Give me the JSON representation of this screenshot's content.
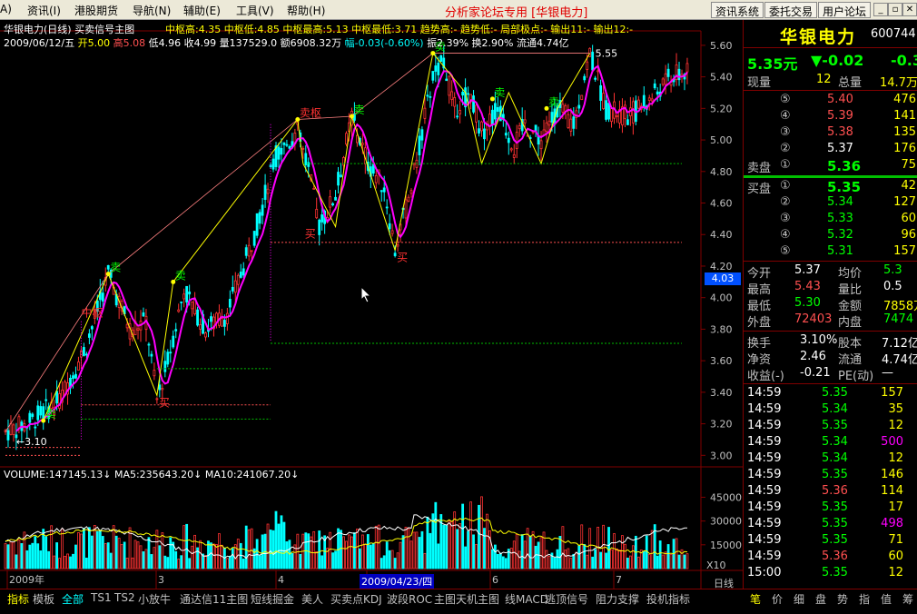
{
  "menu": {
    "items": [
      "A)",
      "资讯(I)",
      "港股期货",
      "导航(N)",
      "辅助(E)",
      "工具(V)",
      "帮助(H)"
    ],
    "center_title": "分析家论坛专用 [华银电力]",
    "sys_buttons": [
      "资讯系统",
      "委托交易",
      "用户论坛"
    ]
  },
  "chart": {
    "title": "华银电力(日线) 买卖信号主图",
    "indicators_line": "中枢高:4.35  中枢低:4.85  中枢最高:5.13  中枢最低:3.71  趋势高:-  趋势低:-  局部极点:-  输出11:-  输出12:-",
    "price_line_date": "2009/06/12/五",
    "price_line_open": "开5.00",
    "price_line_high": "高5.08",
    "price_line_low": "低4.96",
    "price_line_close": "收4.99",
    "price_line_vol": "量137529.0",
    "price_line_amt": "额6908.32万",
    "price_line_range": "幅-0.03(-0.60%)",
    "price_line_amp": "振2.39%",
    "price_line_turn": "换2.90%",
    "price_line_float": "流通4.74亿",
    "y_ticks": [
      "5.60",
      "5.40",
      "5.20",
      "5.00",
      "4.80",
      "4.60",
      "4.40",
      "4.20",
      "4.00",
      "3.80",
      "3.60",
      "3.40",
      "3.20",
      "3.00"
    ],
    "y_range": [
      2.95,
      5.68
    ],
    "cursor_price": "4.03",
    "label_min": "←3.10",
    "label_max": "5.55",
    "label_center": "中枢",
    "sell_signal": "卖",
    "buy_signal": "买",
    "sell_center": "卖枢",
    "volume_line": "VOLUME:147145.13↓  MA5:235643.20↓  MA10:241067.20↓",
    "vol_ticks": [
      "45000",
      "30000",
      "15000"
    ],
    "vol_unit": "X10",
    "x_labels": [
      "2009年",
      "3",
      "4",
      "5",
      "6",
      "7"
    ],
    "x_highlight": "2009/04/23/四",
    "period": "日线",
    "colors": {
      "up": "#ff3232",
      "down": "#00ffff",
      "ma": "#ff00ff",
      "white": "#ffffff",
      "yellow": "#ffff00"
    }
  },
  "quote": {
    "name": "华银电力",
    "code": "600744",
    "price": "5.35元",
    "change": "▼-0.02",
    "change_pct": "-0.3",
    "xianliang_label": "现量",
    "xianliang": "12",
    "zongliang_label": "总量",
    "zongliang": "14.7万",
    "sell_label": "卖盘",
    "buy_label": "买盘",
    "sells": [
      {
        "lv": "⑤",
        "p": "5.40",
        "v": "476"
      },
      {
        "lv": "④",
        "p": "5.39",
        "v": "141"
      },
      {
        "lv": "③",
        "p": "5.38",
        "v": "135"
      },
      {
        "lv": "②",
        "p": "5.37",
        "v": "176"
      },
      {
        "lv": "①",
        "p": "5.36",
        "v": "75"
      }
    ],
    "buys": [
      {
        "lv": "①",
        "p": "5.35",
        "v": "42"
      },
      {
        "lv": "②",
        "p": "5.34",
        "v": "127"
      },
      {
        "lv": "③",
        "p": "5.33",
        "v": "60"
      },
      {
        "lv": "④",
        "p": "5.32",
        "v": "96"
      },
      {
        "lv": "⑤",
        "p": "5.31",
        "v": "157"
      }
    ],
    "stats": [
      {
        "l1": "今开",
        "v1": "5.37",
        "l2": "均价",
        "v2": "5.3"
      },
      {
        "l1": "最高",
        "v1": "5.43",
        "l2": "量比",
        "v2": "0.5"
      },
      {
        "l1": "最低",
        "v1": "5.30",
        "l2": "金额",
        "v2": "7858万"
      },
      {
        "l1": "外盘",
        "v1": "72403",
        "l2": "内盘",
        "v2": "7474"
      }
    ],
    "stats2": [
      {
        "l1": "换手",
        "v1": "3.10%",
        "l2": "股本",
        "v2": "7.12亿"
      },
      {
        "l1": "净资",
        "v1": "2.46",
        "l2": "流通",
        "v2": "4.74亿"
      },
      {
        "l1": "收益(-)",
        "v1": "-0.21",
        "l2": "PE(动)",
        "v2": "—"
      }
    ],
    "ticks": [
      {
        "t": "14:59",
        "p": "5.35",
        "v": "157"
      },
      {
        "t": "14:59",
        "p": "5.34",
        "v": "35"
      },
      {
        "t": "14:59",
        "p": "5.35",
        "v": "12"
      },
      {
        "t": "14:59",
        "p": "5.34",
        "v": "500"
      },
      {
        "t": "14:59",
        "p": "5.34",
        "v": "12"
      },
      {
        "t": "14:59",
        "p": "5.35",
        "v": "146"
      },
      {
        "t": "14:59",
        "p": "5.36",
        "v": "114"
      },
      {
        "t": "14:59",
        "p": "5.35",
        "v": "17"
      },
      {
        "t": "14:59",
        "p": "5.35",
        "v": "498"
      },
      {
        "t": "14:59",
        "p": "5.35",
        "v": "71"
      },
      {
        "t": "14:59",
        "p": "5.36",
        "v": "60"
      },
      {
        "t": "15:00",
        "p": "5.35",
        "v": "12"
      }
    ]
  },
  "bottom_tabs": [
    "指标",
    "模板",
    "全部",
    "TS1",
    "TS2",
    "小放牛",
    "通达信11主图",
    "短线掘金",
    "美人",
    "买卖点KDJ",
    "波段ROC",
    "主图天机主图",
    "线MACD",
    "逃顶信号",
    "阻力支撑",
    "投机指标"
  ],
  "right_tabs": [
    "笔",
    "价",
    "细",
    "盘",
    "势",
    "指",
    "值",
    "筹"
  ]
}
